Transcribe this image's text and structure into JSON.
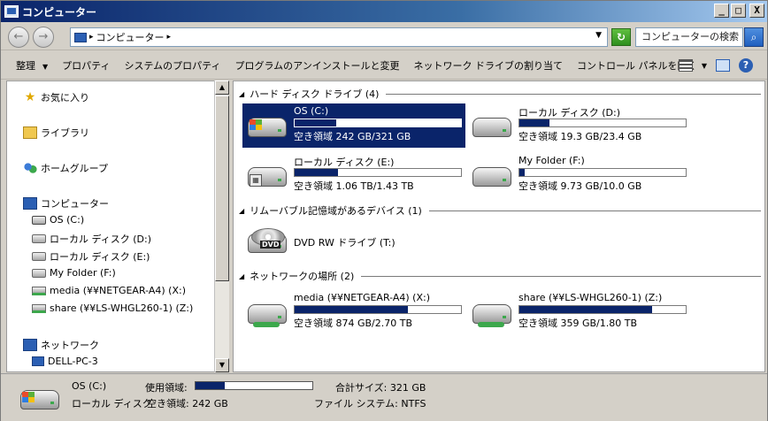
{
  "window": {
    "title": "コンピューター"
  },
  "window_buttons": {
    "minimize": "_",
    "maximize": "□",
    "close": "X"
  },
  "address": {
    "crumb": "コンピューター",
    "search_placeholder": "コンピューターの検索"
  },
  "commands": [
    "整理",
    "プロパティ",
    "システムのプロパティ",
    "プログラムのアンインストールと変更",
    "ネットワーク ドライブの割り当て",
    "コントロール パネルを開く"
  ],
  "nav": {
    "favorites": "お気に入り",
    "libraries": "ライブラリ",
    "homegroup": "ホームグループ",
    "computer": "コンピューター",
    "drives": [
      "OS (C:)",
      "ローカル ディスク (D:)",
      "ローカル ディスク (E:)",
      "My Folder (F:)",
      "media (¥¥NETGEAR-A4) (X:)",
      "share (¥¥LS-WHGL260-1) (Z:)"
    ],
    "network": "ネットワーク",
    "network_pc": "DELL-PC-3"
  },
  "groups": {
    "hdd": "ハード ディスク ドライブ (4)",
    "removable": "リムーバブル記憶域があるデバイス (1)",
    "network": "ネットワークの場所 (2)"
  },
  "tiles": [
    {
      "name": "OS (C:)",
      "space": "空き領域 242 GB/321 GB",
      "used_fraction": 0.25,
      "icon": "windows-drive-icon",
      "selected": true
    },
    {
      "name": "ローカル ディスク (D:)",
      "space": "空き領域 19.3 GB/23.4 GB",
      "used_fraction": 0.18,
      "icon": "hard-drive-icon",
      "selected": false
    },
    {
      "name": "ローカル ディスク (E:)",
      "space": "空き領域 1.06 TB/1.43 TB",
      "used_fraction": 0.26,
      "icon": "hard-drive-icon",
      "selected": false
    },
    {
      "name": "My Folder (F:)",
      "space": "空き領域 9.73 GB/10.0 GB",
      "used_fraction": 0.03,
      "icon": "hard-drive-icon",
      "selected": false
    },
    {
      "name": "DVD RW ドライブ (T:)",
      "icon": "dvd-drive-icon"
    },
    {
      "name": "media (¥¥NETGEAR-A4) (X:)",
      "space": "空き領域 874 GB/2.70 TB",
      "used_fraction": 0.68,
      "icon": "network-drive-icon",
      "selected": false
    },
    {
      "name": "share (¥¥LS-WHGL260-1) (Z:)",
      "space": "空き領域 359 GB/1.80 TB",
      "used_fraction": 0.8,
      "icon": "network-drive-icon",
      "selected": false
    }
  ],
  "details": {
    "name": "OS (C:)",
    "type": "ローカル ディスク",
    "used_label": "使用領域:",
    "used_fraction": 0.25,
    "free": "空き領域: 242 GB",
    "total": "合計サイズ: 321 GB",
    "fs": "ファイル システム: NTFS"
  }
}
